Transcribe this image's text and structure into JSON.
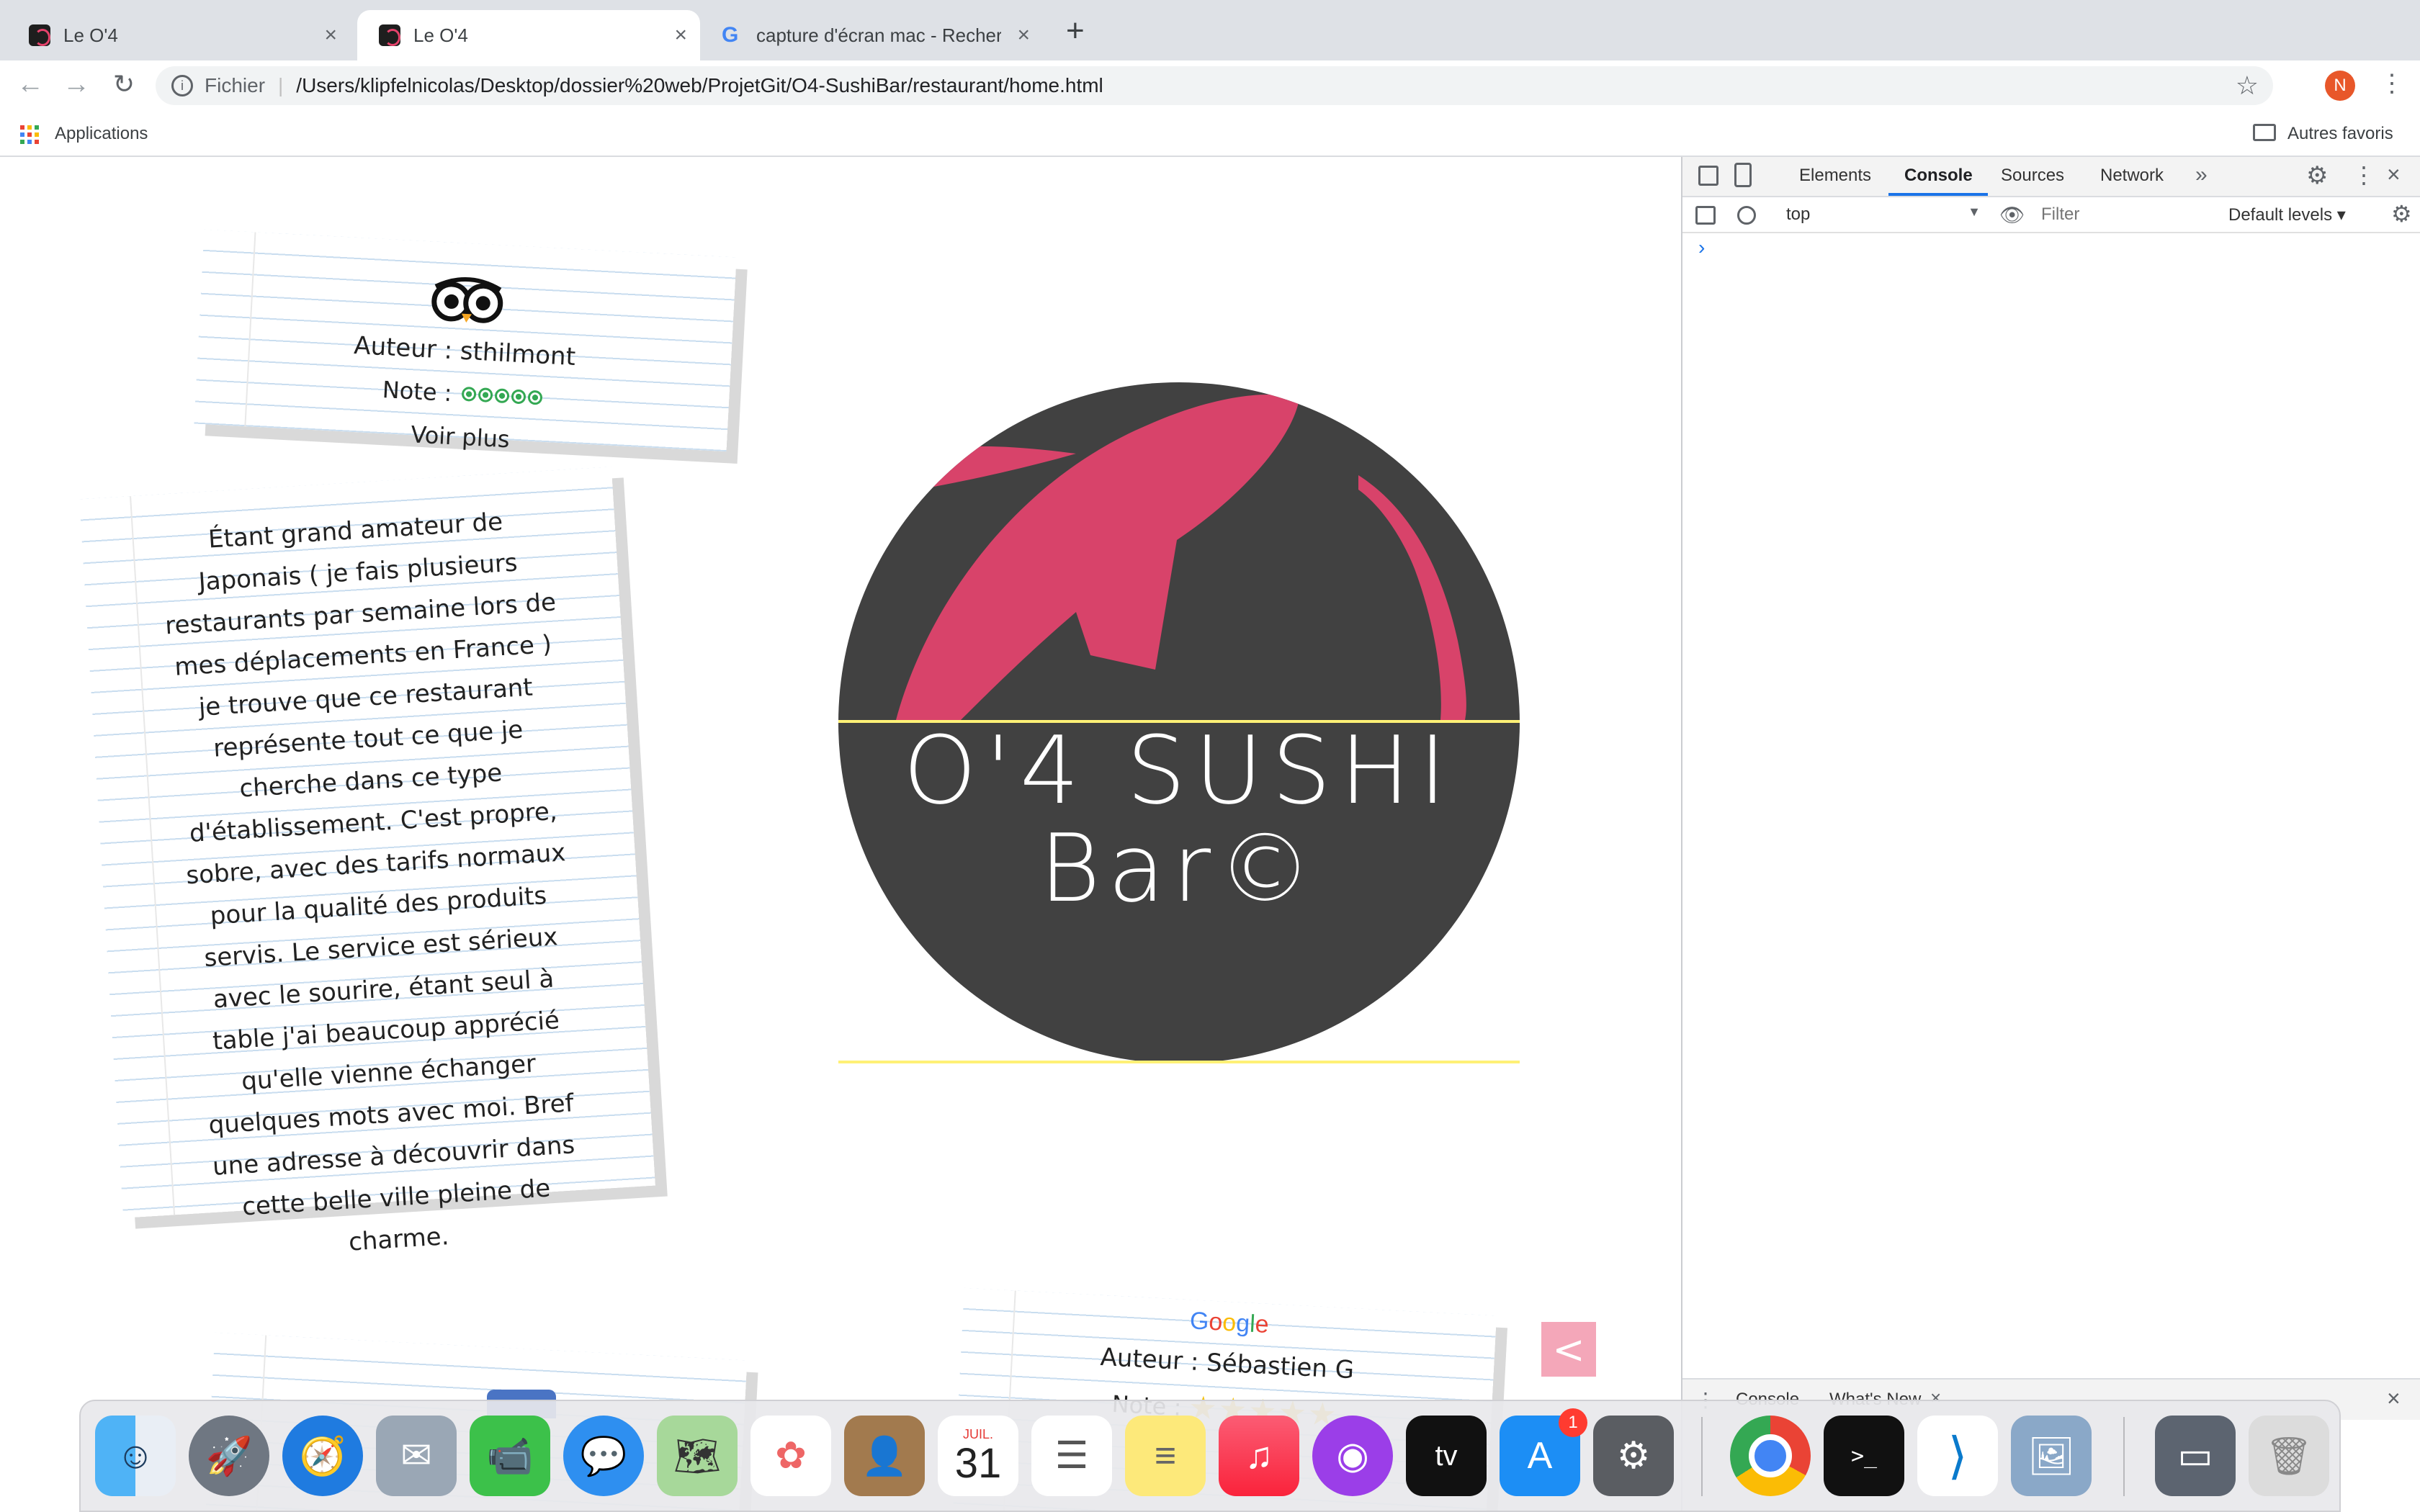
{
  "browser": {
    "tabs": [
      {
        "title": "Le O'4",
        "active": false
      },
      {
        "title": "Le O'4",
        "active": true
      },
      {
        "title": "capture d'écran mac - Recherc",
        "active": false
      }
    ],
    "new_tab_symbol": "+",
    "address": {
      "scheme_label": "Fichier",
      "url": "/Users/klipfelnicolas/Desktop/dossier%20web/ProjetGit/O4-SushiBar/restaurant/home.html"
    },
    "profile_initial": "N",
    "bookmarks": {
      "apps_label": "Applications",
      "other_label": "Autres favoris"
    }
  },
  "page": {
    "review_tripadvisor": {
      "author_label": "Auteur : sthilmont",
      "note_label": "Note :",
      "rating": 5,
      "more_label": "Voir plus"
    },
    "review_text": "Étant grand amateur de Japonais ( je fais plusieurs restaurants par semaine lors de mes déplacements en France ) je trouve que ce restaurant représente tout ce que je cherche dans ce type d'établissement. C'est propre, sobre, avec des tarifs normaux pour la qualité des produits servis. Le service est sérieux avec le sourire, étant seul à table j'ai beaucoup apprécié qu'elle vienne échanger quelques mots avec moi. Bref une adresse à découvrir dans cette belle ville pleine de charme.",
    "logo": {
      "line1": "O'4 SUSHI",
      "line2": "Bar©",
      "circle_color": "#414141",
      "fish_color": "#d8436a",
      "accent_line_color": "#fff176"
    },
    "review_google": {
      "brand": "Google",
      "author_label": "Auteur : Sébastien G",
      "note_label": "Note :"
    },
    "carousel_prev_symbol": "<",
    "carousel_color": "#f4a7b9"
  },
  "devtools": {
    "tabs": [
      "Elements",
      "Console",
      "Sources",
      "Network"
    ],
    "active_tab": "Console",
    "context": "top",
    "filter_placeholder": "Filter",
    "levels": "Default levels ▾",
    "prompt": "›",
    "drawer_tabs": [
      "Console",
      "What's New"
    ]
  },
  "dock": {
    "calendar": {
      "month": "JUIL.",
      "day": "31"
    },
    "appstore_badge": "1",
    "appletv_label": "tv",
    "terminal_prompt": ">_"
  }
}
